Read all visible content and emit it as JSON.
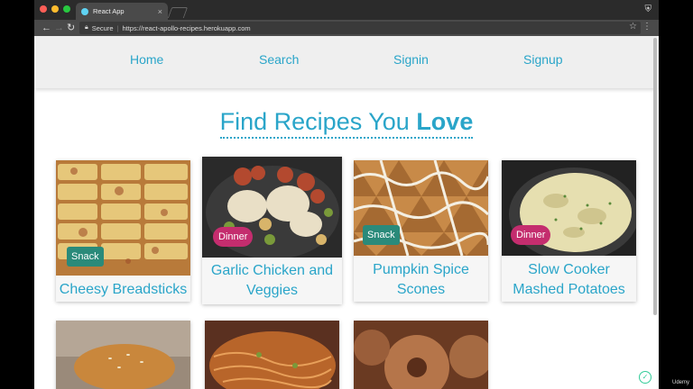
{
  "browser": {
    "tab_title": "React App",
    "secure_label": "Secure",
    "url": "https://react-apollo-recipes.herokuapp.com",
    "traffic_lights": [
      "#ff5f57",
      "#febc2e",
      "#28c840"
    ]
  },
  "nav": {
    "links": [
      "Home",
      "Search",
      "Signin",
      "Signup"
    ]
  },
  "headline": {
    "text": "Find Recipes You",
    "emphasis": "Love"
  },
  "recipes": [
    {
      "name": "Cheesy Breadsticks",
      "category": "Snack"
    },
    {
      "name": "Garlic Chicken and Veggies",
      "category": "Dinner"
    },
    {
      "name": "Pumpkin Spice Scones",
      "category": "Snack"
    },
    {
      "name": "Slow Cooker Mashed Potatoes",
      "category": "Dinner"
    }
  ],
  "watermark": "Udemy",
  "colors": {
    "accent": "#2aa5c9",
    "snack": "#2a8a7a",
    "dinner": "#c42d6e"
  }
}
